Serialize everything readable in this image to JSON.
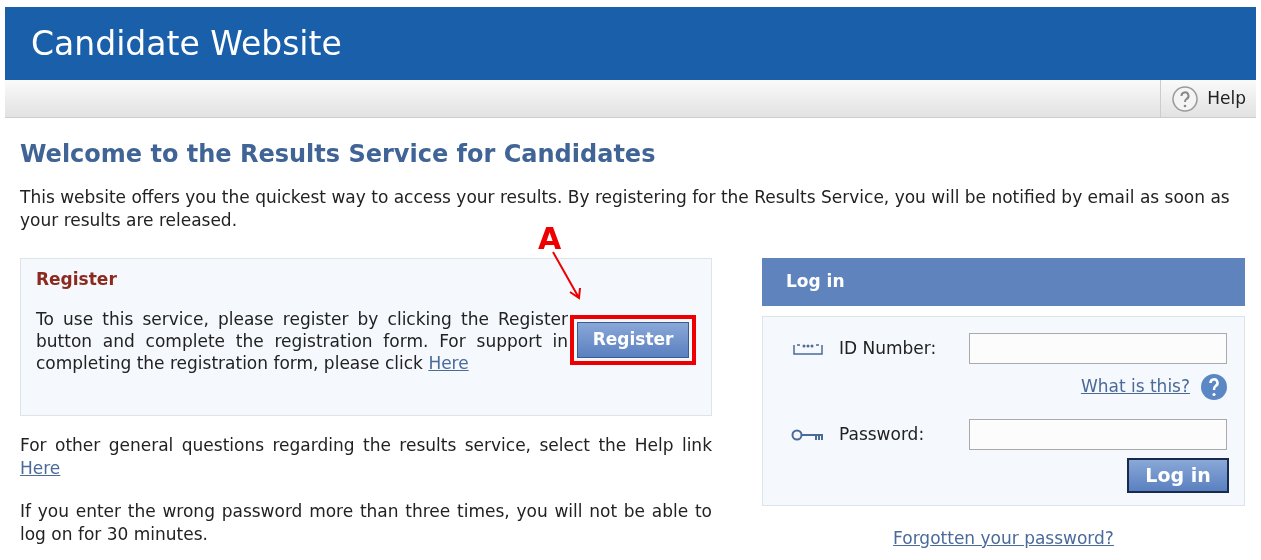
{
  "header": {
    "title": "Candidate Website"
  },
  "toolbar": {
    "help_label": "Help"
  },
  "page": {
    "heading": "Welcome to the Results Service for Candidates",
    "intro": "This website offers you the quickest way to access your results. By registering for the Results Service, you will be notified by email as soon as your results are released.",
    "register_box": {
      "title": "Register",
      "text": "To use this service, please register by clicking the Register button and complete the registration form. For support in completing the registration form, please click",
      "link": "Here",
      "button": "Register"
    },
    "annotation": {
      "label": "A"
    },
    "help_text": "For other general questions regarding the results service, select the Help link",
    "help_link": "Here",
    "warning": "If you enter the wrong password more than three times, you will not be able to log on for 30 minutes."
  },
  "login": {
    "title": "Log in",
    "fields": [
      {
        "kind": "id",
        "label": "ID Number:"
      },
      {
        "kind": "password",
        "label": "Password:"
      }
    ],
    "what_is_this": "What is this?",
    "button": "Log in",
    "forgot": "Forgotten your password?"
  }
}
